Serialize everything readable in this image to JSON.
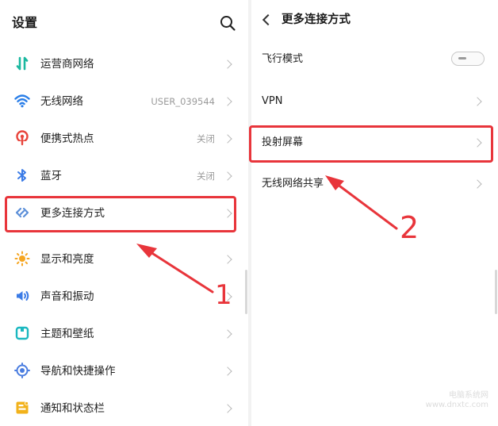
{
  "left": {
    "title": "设置",
    "items": [
      {
        "label": "运营商网络",
        "value": "",
        "icon": "cellular-icon",
        "color": "#1bb8a0"
      },
      {
        "label": "无线网络",
        "value": "USER_039544",
        "icon": "wifi-icon",
        "color": "#2a7ee8"
      },
      {
        "label": "便携式热点",
        "value": "关闭",
        "icon": "hotspot-icon",
        "color": "#e8453c"
      },
      {
        "label": "蓝牙",
        "value": "关闭",
        "icon": "bluetooth-icon",
        "color": "#3b7be6"
      },
      {
        "label": "更多连接方式",
        "value": "",
        "icon": "more-connections-icon",
        "color": "#5a8ed8"
      },
      {
        "label": "显示和亮度",
        "value": "",
        "icon": "sun-icon",
        "color": "#f5a623"
      },
      {
        "label": "声音和振动",
        "value": "",
        "icon": "speaker-icon",
        "color": "#3b7be6"
      },
      {
        "label": "主题和壁纸",
        "value": "",
        "icon": "theme-icon",
        "color": "#1bb8c0"
      },
      {
        "label": "导航和快捷操作",
        "value": "",
        "icon": "navigation-icon",
        "color": "#4a7de0"
      },
      {
        "label": "通知和状态栏",
        "value": "",
        "icon": "notification-icon",
        "color": "#f2b21b"
      }
    ]
  },
  "right": {
    "title": "更多连接方式",
    "items": [
      {
        "label": "飞行模式",
        "control": "toggle",
        "state": "off"
      },
      {
        "label": "VPN",
        "control": "chevron"
      },
      {
        "label": "投射屏幕",
        "control": "chevron"
      },
      {
        "label": "无线网络共享",
        "control": "chevron"
      }
    ]
  },
  "annotations": {
    "step1": "1",
    "step2": "2",
    "color": "#e8353b"
  },
  "watermark": {
    "line1": "电脑系统网",
    "line2": "www.dnxtc.com"
  }
}
